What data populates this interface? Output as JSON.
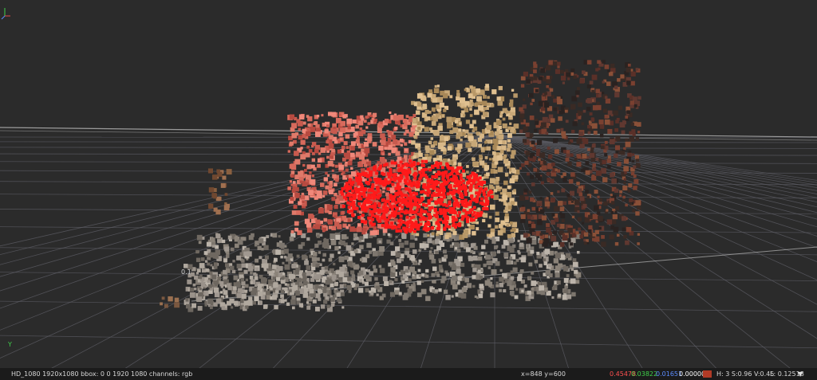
{
  "viewer": {
    "grid_label": "0.1",
    "axis_y_label": "Y",
    "background_color": "#2b2b2b",
    "grid_color": "#5e5e66",
    "horizon_color": "#a8a8a8",
    "highlight_color": "#ff1a1a"
  },
  "status": {
    "format_info": "HD_1080 1920x1080  bbox: 0 0 1920 1080 channels: rgb",
    "coords": "x=848 y=600",
    "r": "0.45478",
    "g": "0.03822",
    "b": "0.01651",
    "a": "0.00000",
    "hsv": "H:   3 S:0.96 V:0.45",
    "lum": "L: 0.12518",
    "swatch_color": "#b03a26",
    "menu_icon": "triangle-down-icon",
    "r_color": "#ff5050",
    "g_color": "#3fd04a",
    "b_color": "#5b8cff",
    "a_color": "#ffffff"
  }
}
